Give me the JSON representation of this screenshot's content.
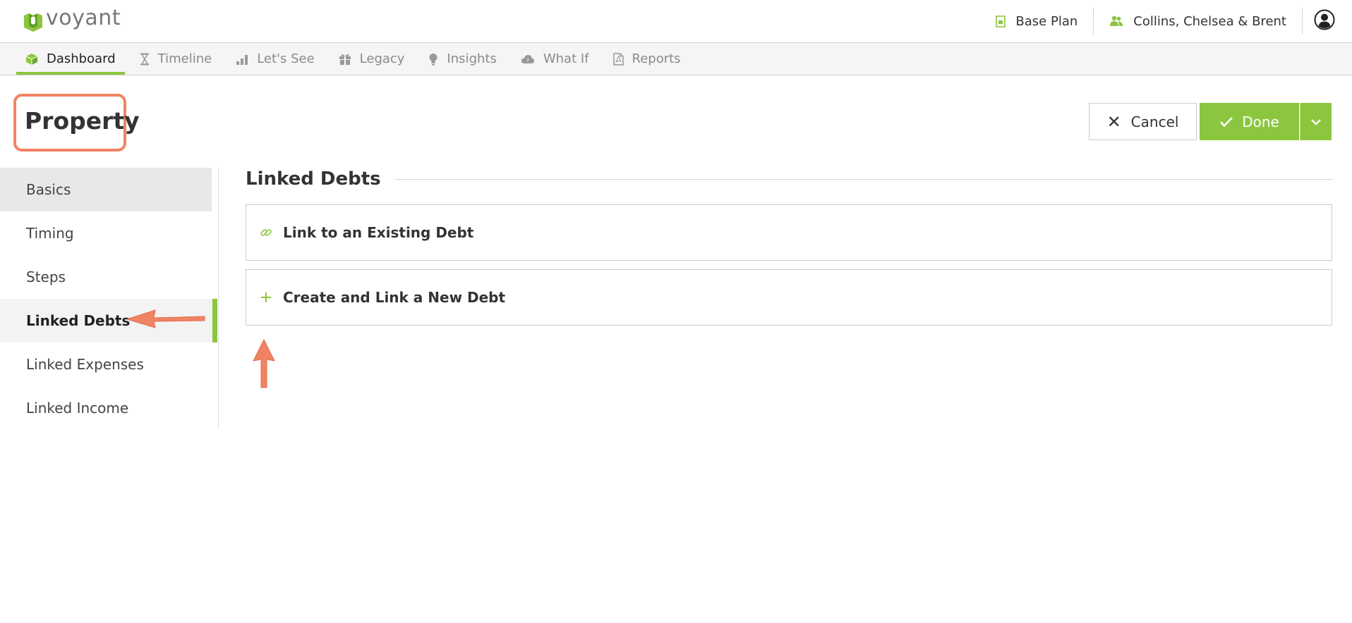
{
  "brand": {
    "name": "voyant",
    "accent": "#8cc63f",
    "annotation": "#f08363"
  },
  "header": {
    "plan_label": "Base Plan",
    "plan_icon": "plan-icon",
    "client_label": "Collins, Chelsea & Brent",
    "client_icon": "people-icon",
    "account_icon": "user-circle-icon"
  },
  "nav": {
    "tabs": [
      {
        "label": "Dashboard",
        "icon": "cube-icon",
        "active": true
      },
      {
        "label": "Timeline",
        "icon": "hourglass-icon",
        "active": false
      },
      {
        "label": "Let's See",
        "icon": "bar-chart-icon",
        "active": false
      },
      {
        "label": "Legacy",
        "icon": "gift-icon",
        "active": false
      },
      {
        "label": "Insights",
        "icon": "lightbulb-icon",
        "active": false
      },
      {
        "label": "What If",
        "icon": "cloud-icon",
        "active": false
      },
      {
        "label": "Reports",
        "icon": "pdf-icon",
        "active": false
      }
    ]
  },
  "page": {
    "title": "Property",
    "cancel_label": "Cancel",
    "done_label": "Done"
  },
  "sidebar": {
    "items": [
      {
        "label": "Basics",
        "state": "highlighted"
      },
      {
        "label": "Timing",
        "state": "normal"
      },
      {
        "label": "Steps",
        "state": "normal"
      },
      {
        "label": "Linked Debts",
        "state": "active"
      },
      {
        "label": "Linked Expenses",
        "state": "normal"
      },
      {
        "label": "Linked Income",
        "state": "normal"
      }
    ]
  },
  "main": {
    "section_title": "Linked Debts",
    "actions": [
      {
        "label": "Link to an Existing Debt",
        "icon": "link-icon"
      },
      {
        "label": "Create and Link a New Debt",
        "icon": "plus-icon"
      }
    ]
  }
}
